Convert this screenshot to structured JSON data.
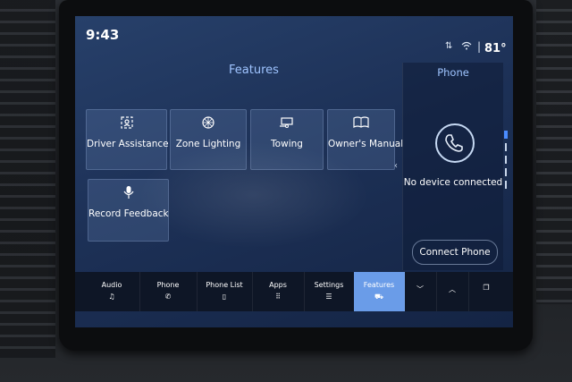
{
  "status": {
    "time": "9:43",
    "temperature": "81°"
  },
  "features": {
    "title": "Features",
    "tiles": [
      {
        "label": "Driver Assistance",
        "icon": "driver-assist-icon"
      },
      {
        "label": "Zone Lighting",
        "icon": "zone-lighting-icon"
      },
      {
        "label": "Towing",
        "icon": "towing-icon"
      },
      {
        "label": "Owner's Manual",
        "icon": "manual-icon"
      },
      {
        "label": "Record Feedback",
        "icon": "microphone-icon"
      }
    ]
  },
  "phone": {
    "title": "Phone",
    "status": "No device connected",
    "connect_label": "Connect Phone"
  },
  "nav": [
    {
      "label": "Audio",
      "icon": "music-note-icon"
    },
    {
      "label": "Phone",
      "icon": "phone-icon"
    },
    {
      "label": "Phone List",
      "icon": "phone-list-icon"
    },
    {
      "label": "Apps",
      "icon": "apps-grid-icon"
    },
    {
      "label": "Settings",
      "icon": "sliders-icon"
    },
    {
      "label": "Features",
      "icon": "vehicle-icon",
      "active": true
    },
    {
      "label": "",
      "icon": "chevron-down-icon"
    },
    {
      "label": "",
      "icon": "chevron-up-icon"
    },
    {
      "label": "",
      "icon": "windows-icon"
    }
  ],
  "colors": {
    "screen": "#1d3157",
    "accent": "#9fc4ff",
    "active_tab": "#6a9ce8"
  }
}
